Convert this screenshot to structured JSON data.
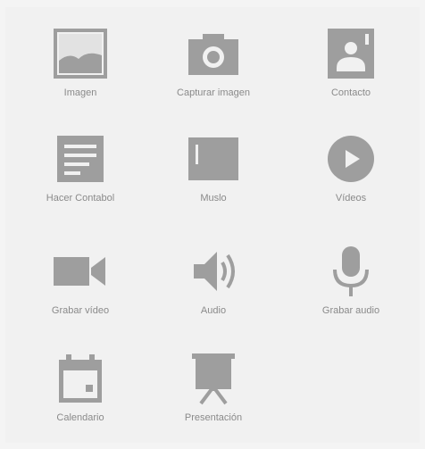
{
  "colors": {
    "icon": "#9e9e9e",
    "icon_dark": "#8c8c8c",
    "label": "#8a8a8a",
    "background": "#f1f1f1"
  },
  "items": [
    {
      "label": "Imagen",
      "icon": "image-icon"
    },
    {
      "label": "Capturar imagen",
      "icon": "camera-icon"
    },
    {
      "label": "Contacto",
      "icon": "contact-icon"
    },
    {
      "label": "Hacer Contabol",
      "icon": "document-list-icon"
    },
    {
      "label": "Muslo",
      "icon": "notebook-icon"
    },
    {
      "label": "Vídeos",
      "icon": "play-circle-icon"
    },
    {
      "label": "Grabar vídeo",
      "icon": "video-camera-icon"
    },
    {
      "label": "Audio",
      "icon": "speaker-icon"
    },
    {
      "label": "Grabar audio",
      "icon": "microphone-icon"
    },
    {
      "label": "Calendario",
      "icon": "calendar-icon"
    },
    {
      "label": "Presentación",
      "icon": "presentation-icon"
    }
  ]
}
